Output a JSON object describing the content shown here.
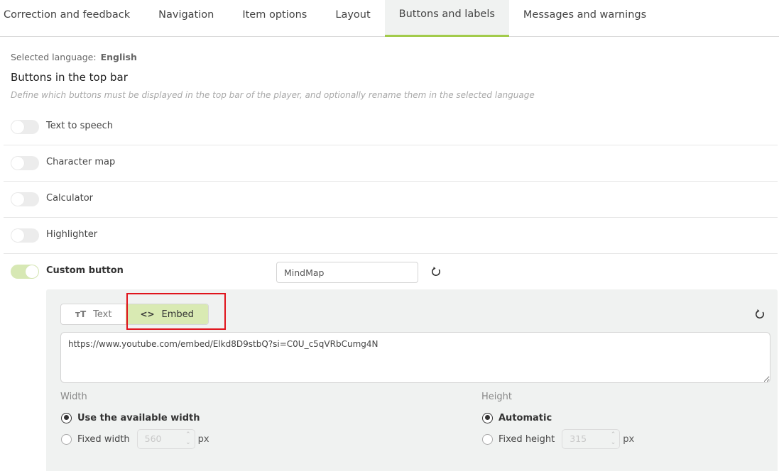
{
  "tabs": [
    {
      "label": "Correction and feedback",
      "active": false
    },
    {
      "label": "Navigation",
      "active": false
    },
    {
      "label": "Item options",
      "active": false
    },
    {
      "label": "Layout",
      "active": false
    },
    {
      "label": "Buttons and labels",
      "active": true
    },
    {
      "label": "Messages and warnings",
      "active": false
    }
  ],
  "language": {
    "label": "Selected language:",
    "value": "English"
  },
  "section": {
    "title": "Buttons in the top bar",
    "description": "Define which buttons must be displayed in the top bar of the player, and optionally rename them in the selected language"
  },
  "buttons": [
    {
      "label": "Text to speech",
      "enabled": false
    },
    {
      "label": "Character map",
      "enabled": false
    },
    {
      "label": "Calculator",
      "enabled": false
    },
    {
      "label": "Highlighter",
      "enabled": false
    },
    {
      "label": "Custom button",
      "enabled": true,
      "name_value": "MindMap"
    }
  ],
  "custom_panel": {
    "mode_options": [
      {
        "label": "Text",
        "icon": "text-size-icon",
        "glyph": "тT",
        "active": false
      },
      {
        "label": "Embed",
        "icon": "code-icon",
        "glyph": "<>",
        "active": true
      }
    ],
    "embed_value": "https://www.youtube.com/embed/Elkd8D9stbQ?si=C0U_c5qVRbCumg4N",
    "width": {
      "label": "Width",
      "options": [
        {
          "label": "Use the available width",
          "checked": true
        },
        {
          "label": "Fixed width",
          "checked": false
        }
      ],
      "fixed_value": "560",
      "unit": "px"
    },
    "height": {
      "label": "Height",
      "options": [
        {
          "label": "Automatic",
          "checked": true
        },
        {
          "label": "Fixed height",
          "checked": false
        }
      ],
      "fixed_value": "315",
      "unit": "px"
    }
  },
  "colors": {
    "accent": "#a2cb4a",
    "toggle_on": "#d7e8b4",
    "segment_active": "#d9eab3",
    "highlight": "#e0141c",
    "panel_bg": "#f0f2f1"
  }
}
